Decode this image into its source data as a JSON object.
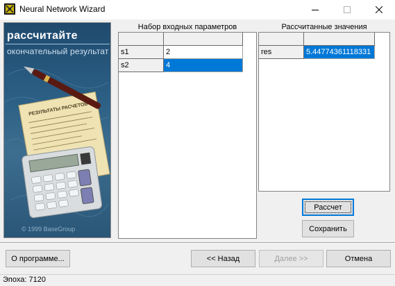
{
  "window": {
    "title": "Neural Network Wizard"
  },
  "banner": {
    "title": "рассчитайте",
    "subtitle": "окончательный результат",
    "copyright": "© 1999 BaseGroup",
    "paper_heading": "РЕЗУЛЬТАТЫ РАСЧЕТОВ"
  },
  "input_grid": {
    "title": "Набор входных параметров",
    "rows": [
      {
        "name": "s1",
        "value": "2"
      },
      {
        "name": "s2",
        "value": "4"
      }
    ]
  },
  "output_grid": {
    "title": "Рассчитанные значения",
    "rows": [
      {
        "name": "res",
        "value": "5.44774361118331"
      }
    ]
  },
  "buttons": {
    "calculate": "Рассчет",
    "save": "Сохранить",
    "about": "О программе...",
    "back": "<< Назад",
    "next": "Далее >>",
    "cancel": "Отмена"
  },
  "status": {
    "text": "Эпоха: 7120"
  }
}
